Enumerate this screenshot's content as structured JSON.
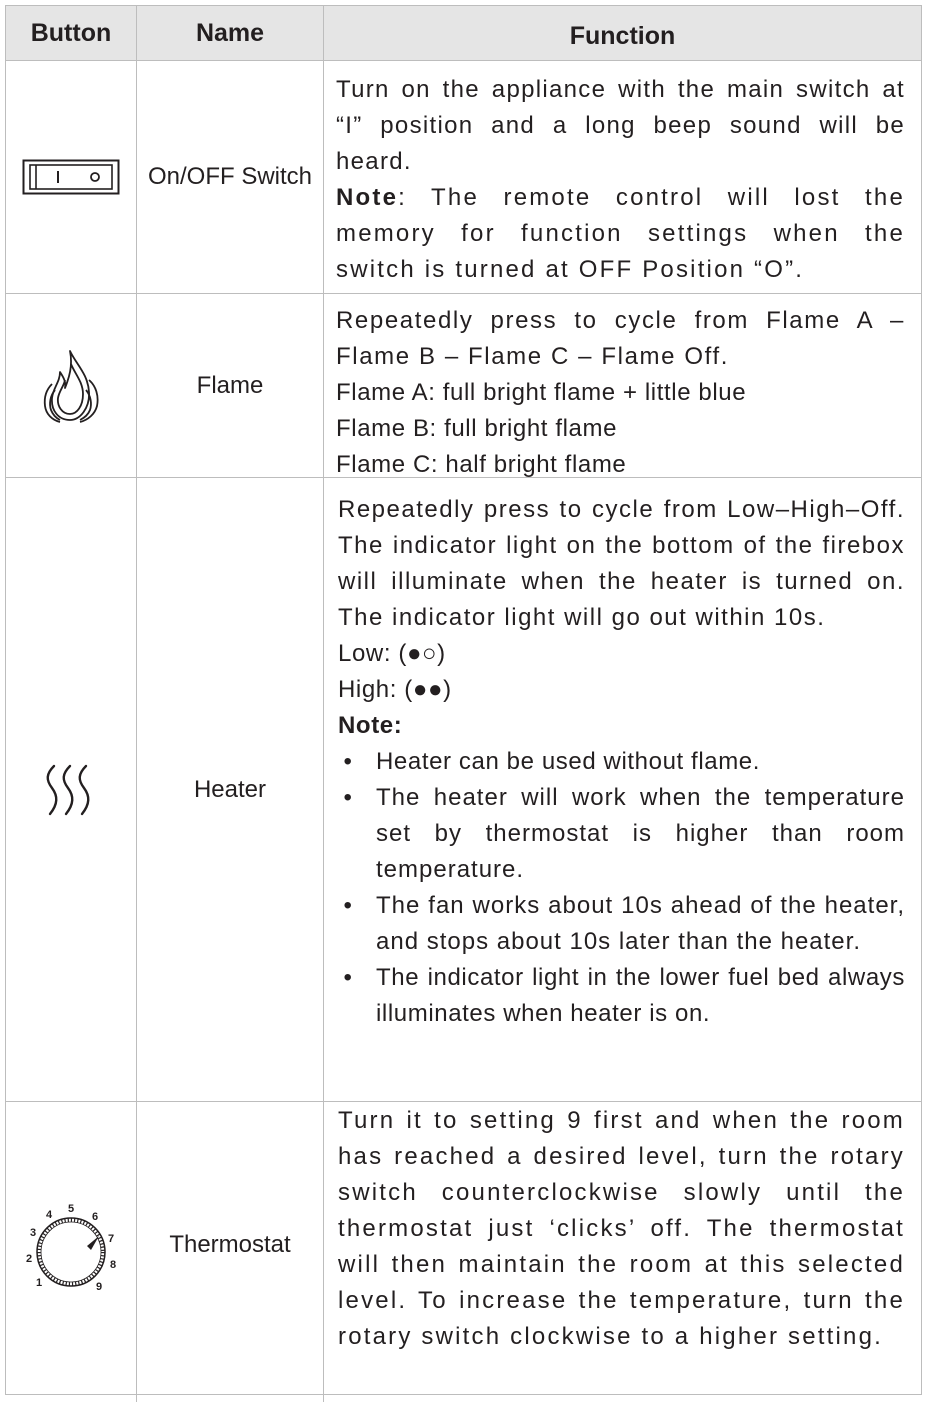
{
  "header": {
    "col_button": "Button",
    "col_name": "Name",
    "col_function": "Function"
  },
  "rows": [
    {
      "name": "On/OFF Switch",
      "icon": "rocker-switch-icon",
      "text1": "Turn on the appliance with the main switch at “I” position and a long beep sound will be heard.",
      "note_label": "Note",
      "note_text": ": The remote control will lost the memory for function settings when the switch is turned at OFF Position “O”."
    },
    {
      "name": "Flame",
      "icon": "flame-icon",
      "lines": [
        "Repeatedly press to cycle from Flame A –Flame B – Flame C – Flame Off.",
        "Flame A: full bright flame + little blue",
        "Flame B: full bright flame",
        "Flame C: half bright flame"
      ]
    },
    {
      "name": "Heater",
      "icon": "heat-waves-icon",
      "intro": "Repeatedly press to cycle from Low–High–Off. The indicator light on the bottom of the firebox will illuminate when the heater is turned on. The indicator light will go out within 10s.",
      "low": "Low: (●○)",
      "high": "High: (●●)",
      "note_label": "Note:",
      "bullet": "•",
      "bullets": [
        "Heater can be used without flame.",
        "The heater will work when the temperature set by thermostat is higher than room temperature.",
        "The fan works about 10s ahead of the heater, and stops about 10s later than the heater.",
        "The indicator light in the lower fuel bed always illuminates when heater is on."
      ]
    },
    {
      "name": "Thermostat",
      "icon": "thermostat-dial-icon",
      "dial_numbers": [
        "1",
        "2",
        "3",
        "4",
        "5",
        "6",
        "7",
        "8",
        "9"
      ],
      "text": "Turn it to setting 9 first and when the room has reached a desired level, turn the rotary switch counterclockwise slowly until the thermostat just ‘clicks’ off. The thermostat will then maintain the room at this selected level. To increase the temperature, turn the rotary switch clockwise to a higher setting."
    }
  ]
}
